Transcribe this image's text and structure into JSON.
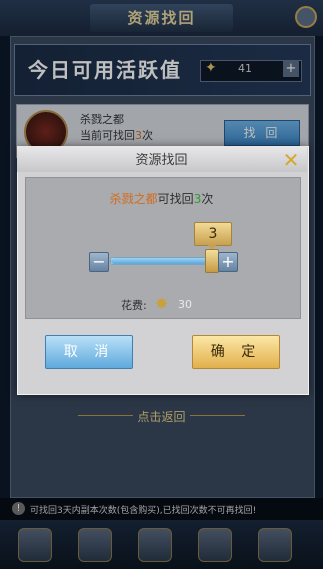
{
  "background": {
    "title": "资源找回",
    "banner_text": "今日可用活跃值",
    "active_value": "41",
    "plus": "+",
    "row": {
      "name": "杀戮之都",
      "count_prefix": "当前可找回",
      "count_value": "3",
      "count_suffix": "次",
      "button": "找 回"
    },
    "back_link": "点击返回",
    "tip_icon": "!",
    "tip": "可找回3天内副本次数(包含购买),已找回次数不可再找回!"
  },
  "dialog": {
    "title": "资源找回",
    "message": {
      "dungeon": "杀戮之都",
      "middle": "可找回",
      "count": "3",
      "suffix": "次"
    },
    "slider": {
      "value": "3",
      "fraction": 1.0,
      "minus": "−",
      "plus": "+"
    },
    "cost_label": "花费:",
    "cost_value": "30",
    "cancel": "取 消",
    "confirm": "确 定"
  },
  "icons": {
    "close": "close-icon",
    "currency": "star-currency-icon"
  },
  "colors": {
    "highlight_orange": "#d46a1b",
    "highlight_green": "#2f9b2f",
    "gold": "#d9a531",
    "blue_button": "#5fa9dc"
  }
}
